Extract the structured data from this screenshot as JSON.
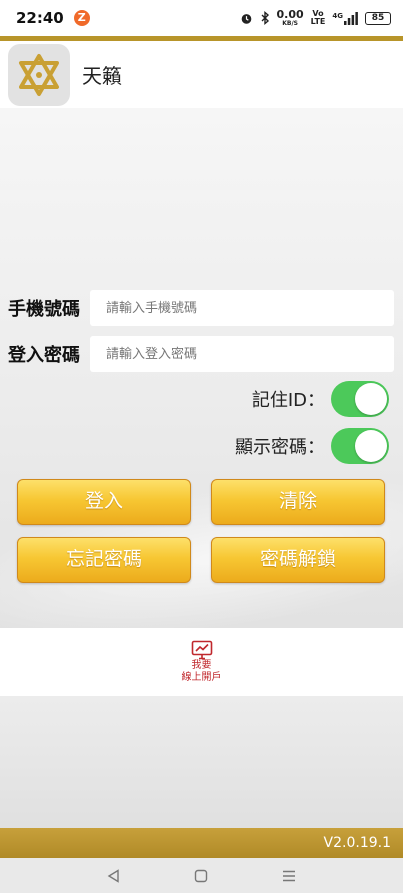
{
  "status_bar": {
    "time": "22:40",
    "app_badge": "Z",
    "net_speed_value": "0.00",
    "net_speed_unit": "KB/S",
    "volte_top": "Vo",
    "volte_bottom": "LTE",
    "network": "4G",
    "battery": "85"
  },
  "header": {
    "title": "天籟"
  },
  "login": {
    "phone_label": "手機號碼",
    "phone_placeholder": "請輸入手機號碼",
    "password_label": "登入密碼",
    "password_placeholder": "請輸入登入密碼",
    "remember_label": "記住ID：",
    "remember_on": true,
    "show_password_label": "顯示密碼：",
    "show_password_on": true
  },
  "buttons": {
    "login": "登入",
    "clear": "清除",
    "forgot": "忘記密碼",
    "unlock": "密碼解鎖"
  },
  "open_account": {
    "line1": "我要",
    "line2": "線上開戶"
  },
  "footer": {
    "version": "V2.0.19.1"
  },
  "colors": {
    "gold": "#b8952a",
    "toggle_on": "#4cc95a",
    "button_gold": "#f7c733",
    "accent_red": "#c0282d"
  }
}
